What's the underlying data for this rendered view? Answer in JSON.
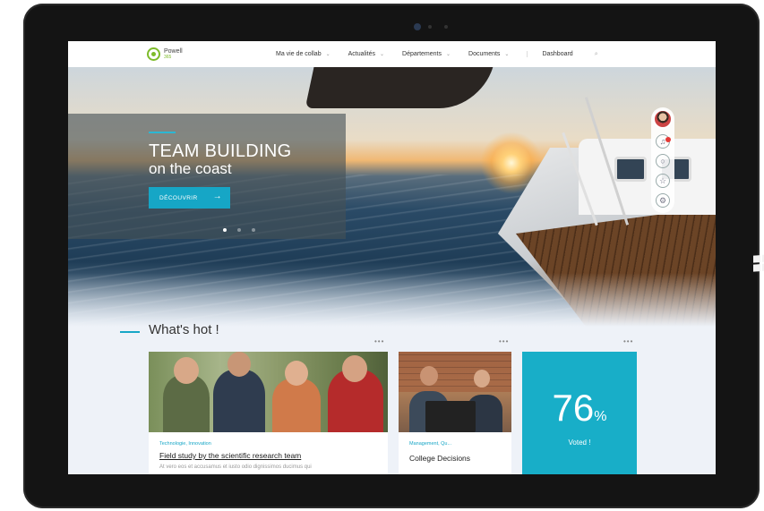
{
  "nav": {
    "brand": "Powell",
    "brand_sub": "365",
    "items": [
      {
        "label": "Ma vie de collab",
        "has_menu": true
      },
      {
        "label": "Actualités",
        "has_menu": true
      },
      {
        "label": "Départements",
        "has_menu": true
      },
      {
        "label": "Documents",
        "has_menu": true
      }
    ],
    "dashboard": "Dashboard"
  },
  "hero": {
    "title": "TEAM BUILDING",
    "subtitle": "on the coast",
    "button_label": "DÉCOUVRIR",
    "button_arrow": "→",
    "slides": 3,
    "active_slide": 1
  },
  "side_tools": {
    "icons": [
      "avatar",
      "bell-icon",
      "search-icon",
      "star-icon",
      "settings-icon"
    ],
    "notification_color": "#e53935"
  },
  "whats_hot": {
    "title": "What's hot !",
    "more_label": "•••",
    "cards": [
      {
        "tag": "Technologie, Innovation",
        "title": "Field study by the scientific research team",
        "text": "At vero eos et accusamus et iusto odio dignissimos ducimus qui"
      },
      {
        "tag": "Management, Qu...",
        "title": "College Decisions"
      }
    ],
    "stat": {
      "value": "76",
      "unit": "%",
      "label": "Voted !"
    }
  },
  "colors": {
    "accent": "#16a6c6",
    "stat_card": "#18aec8",
    "brand_green": "#7dbb2a"
  }
}
